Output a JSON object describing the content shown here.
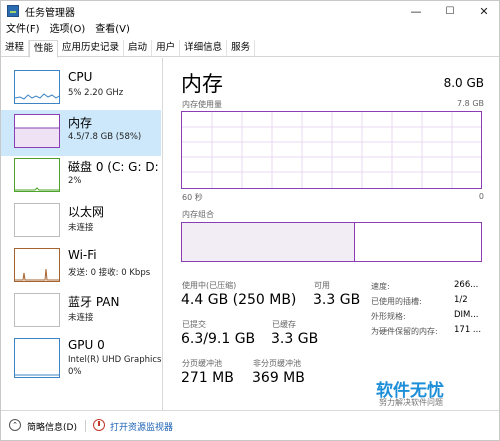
{
  "window": {
    "title": "任务管理器",
    "min_icon": "—",
    "max_icon": "☐",
    "close_icon": "✕"
  },
  "menu": [
    "文件(F)",
    "选项(O)",
    "查看(V)"
  ],
  "tabs": [
    "进程",
    "性能",
    "应用历史记录",
    "启动",
    "用户",
    "详细信息",
    "服务"
  ],
  "sidebar": [
    {
      "name": "CPU",
      "sub1": "5% 2.20 GHz",
      "color": "#3d84c6"
    },
    {
      "name": "内存",
      "sub1": "4.5/7.8 GB (58%)",
      "color": "#8b3db4"
    },
    {
      "name": "磁盘 0 (C: G: D: E",
      "sub1": "2%",
      "color": "#4da22b"
    },
    {
      "name": "以太网",
      "sub1": "未连接",
      "color": "#a9a9a9"
    },
    {
      "name": "Wi-Fi",
      "sub1": "发送: 0 接收: 0 Kbps",
      "color": "#a5632f"
    },
    {
      "name": "蓝牙 PAN",
      "sub1": "未连接",
      "color": "#a9a9a9"
    },
    {
      "name": "GPU 0",
      "sub1": "Intel(R) UHD Graphics",
      "sub2": "0%",
      "color": "#3d84c6"
    }
  ],
  "main": {
    "title": "内存",
    "total": "8.0 GB",
    "usage_label": "内存使用量",
    "usage_max": "7.8 GB",
    "time_label": "60 秒",
    "time_end": "0",
    "composition_label": "内存组合",
    "composition_used_fraction": 0.58
  },
  "stats": {
    "in_use_label": "使用中(已压缩)",
    "in_use": "4.4 GB (250 MB)",
    "available_label": "可用",
    "available": "3.3 GB",
    "committed_label": "已提交",
    "committed": "6.3/9.1 GB",
    "cached_label": "已缓存",
    "cached": "3.3 GB",
    "paged_label": "分页缓冲池",
    "paged": "271 MB",
    "nonpaged_label": "非分页缓冲池",
    "nonpaged": "369 MB"
  },
  "details": [
    {
      "k": "速度:",
      "v": "266..."
    },
    {
      "k": "已使用的插槽:",
      "v": "1/2"
    },
    {
      "k": "外形规格:",
      "v": "DIM..."
    },
    {
      "k": "为硬件保留的内存:",
      "v": "171 ..."
    }
  ],
  "statusbar": {
    "brief": "简略信息(D)",
    "monitor": "打开资源监视器"
  },
  "watermark": {
    "line1": "软件无忧",
    "line2": "努力解决软件问题"
  }
}
